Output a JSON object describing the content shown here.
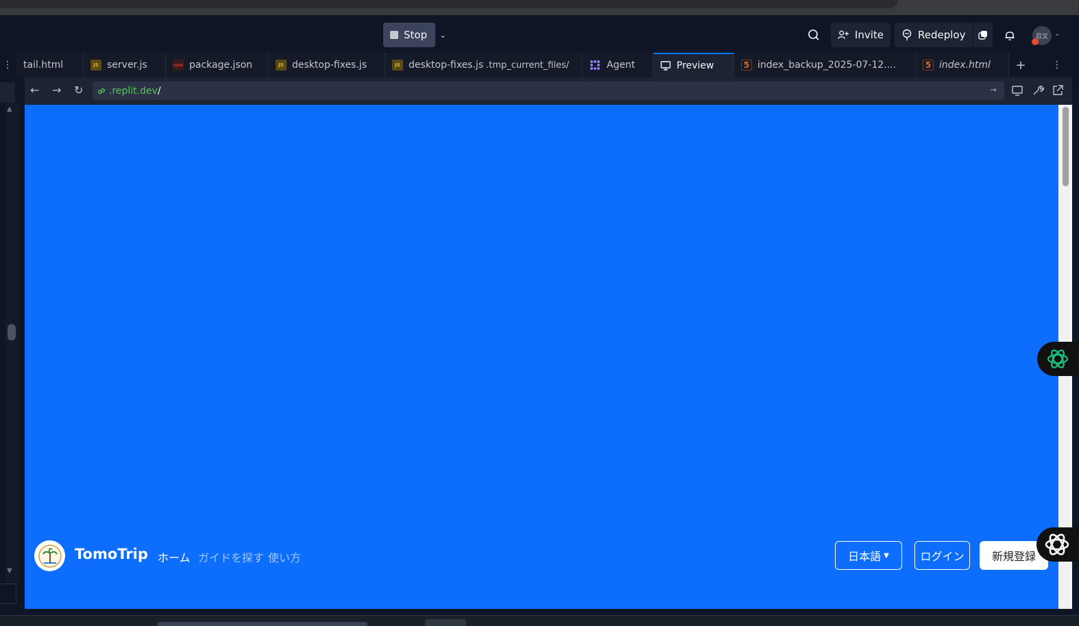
{
  "header": {
    "stop_label": "Stop",
    "invite_label": "Invite",
    "redeploy_label": "Redeploy",
    "avatar_text": "忍又"
  },
  "tabs": [
    {
      "label": "tail.html",
      "icon": "none"
    },
    {
      "label": "server.js",
      "icon": "js-icon"
    },
    {
      "label": "package.json",
      "icon": "json-icon"
    },
    {
      "label": "desktop-fixes.js",
      "icon": "js-icon"
    },
    {
      "label": "desktop-fixes.js",
      "sublabel": ".tmp_current_files/",
      "icon": "js-icon"
    },
    {
      "label": "Agent",
      "icon": "agent-icon"
    },
    {
      "label": "Preview",
      "icon": "monitor-icon",
      "active": true
    },
    {
      "label": "index_backup_2025-07-12....",
      "icon": "html-icon"
    },
    {
      "label": "index.html",
      "icon": "html-icon",
      "italic": true
    }
  ],
  "preview": {
    "url_domain": ".replit.dev",
    "url_path": "/"
  },
  "site": {
    "brand": "TomoTrip",
    "nav": {
      "home": "ホーム",
      "find_guides": "ガイドを探す",
      "how_to": "使い方"
    },
    "language_label": "日本語",
    "login_label": "ログイン",
    "signup_label": "新規登録",
    "background_color": "#0d6efd"
  },
  "colors": {
    "ide_bg": "#0e1525",
    "accent": "#0079f2",
    "url_green": "#58c45c"
  }
}
